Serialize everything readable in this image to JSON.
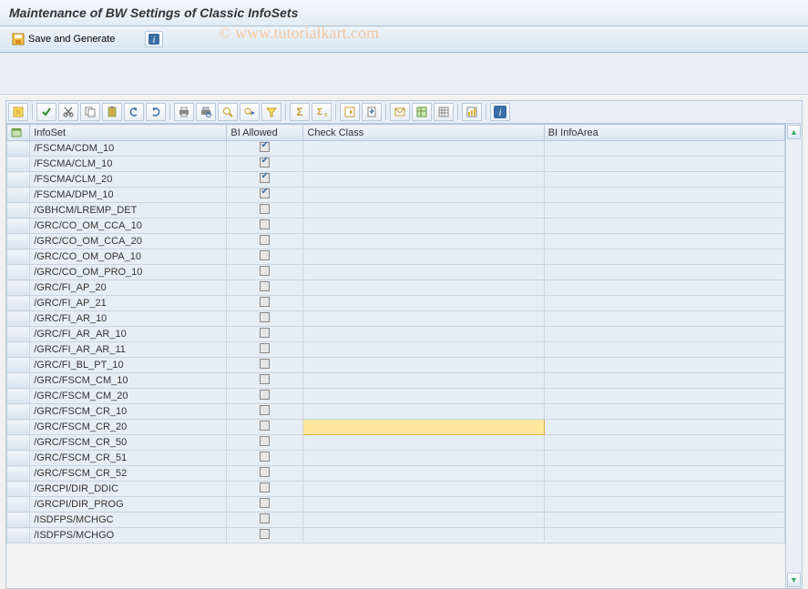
{
  "title": "Maintenance of BW Settings of Classic InfoSets",
  "appbar": {
    "save_label": "Save and Generate"
  },
  "watermark": "© www.tutorialkart.com",
  "columns": {
    "infoset": "InfoSet",
    "bi_allowed": "BI Allowed",
    "check_class": "Check Class",
    "bi_infoarea": "BI InfoArea"
  },
  "rows": [
    {
      "infoset": "/FSCMA/CDM_10",
      "bi": true,
      "cc": "",
      "ia": ""
    },
    {
      "infoset": "/FSCMA/CLM_10",
      "bi": true,
      "cc": "",
      "ia": ""
    },
    {
      "infoset": "/FSCMA/CLM_20",
      "bi": true,
      "cc": "",
      "ia": ""
    },
    {
      "infoset": "/FSCMA/DPM_10",
      "bi": true,
      "cc": "",
      "ia": ""
    },
    {
      "infoset": "/GBHCM/LREMP_DET",
      "bi": false,
      "cc": "",
      "ia": ""
    },
    {
      "infoset": "/GRC/CO_OM_CCA_10",
      "bi": false,
      "cc": "",
      "ia": ""
    },
    {
      "infoset": "/GRC/CO_OM_CCA_20",
      "bi": false,
      "cc": "",
      "ia": ""
    },
    {
      "infoset": "/GRC/CO_OM_OPA_10",
      "bi": false,
      "cc": "",
      "ia": ""
    },
    {
      "infoset": "/GRC/CO_OM_PRO_10",
      "bi": false,
      "cc": "",
      "ia": ""
    },
    {
      "infoset": "/GRC/FI_AP_20",
      "bi": false,
      "cc": "",
      "ia": ""
    },
    {
      "infoset": "/GRC/FI_AP_21",
      "bi": false,
      "cc": "",
      "ia": ""
    },
    {
      "infoset": "/GRC/FI_AR_10",
      "bi": false,
      "cc": "",
      "ia": ""
    },
    {
      "infoset": "/GRC/FI_AR_AR_10",
      "bi": false,
      "cc": "",
      "ia": ""
    },
    {
      "infoset": "/GRC/FI_AR_AR_11",
      "bi": false,
      "cc": "",
      "ia": ""
    },
    {
      "infoset": "/GRC/FI_BL_PT_10",
      "bi": false,
      "cc": "",
      "ia": ""
    },
    {
      "infoset": "/GRC/FSCM_CM_10",
      "bi": false,
      "cc": "",
      "ia": ""
    },
    {
      "infoset": "/GRC/FSCM_CM_20",
      "bi": false,
      "cc": "",
      "ia": ""
    },
    {
      "infoset": "/GRC/FSCM_CR_10",
      "bi": false,
      "cc": "",
      "ia": ""
    },
    {
      "infoset": "/GRC/FSCM_CR_20",
      "bi": false,
      "cc": "",
      "ia": "",
      "editing": true
    },
    {
      "infoset": "/GRC/FSCM_CR_50",
      "bi": false,
      "cc": "",
      "ia": ""
    },
    {
      "infoset": "/GRC/FSCM_CR_51",
      "bi": false,
      "cc": "",
      "ia": ""
    },
    {
      "infoset": "/GRC/FSCM_CR_52",
      "bi": false,
      "cc": "",
      "ia": ""
    },
    {
      "infoset": "/GRCPI/DIR_DDIC",
      "bi": false,
      "cc": "",
      "ia": ""
    },
    {
      "infoset": "/GRCPI/DIR_PROG",
      "bi": false,
      "cc": "",
      "ia": ""
    },
    {
      "infoset": "/ISDFPS/MCHGC",
      "bi": false,
      "cc": "",
      "ia": ""
    },
    {
      "infoset": "/ISDFPS/MCHGO",
      "bi": false,
      "cc": "",
      "ia": ""
    }
  ],
  "toolbar_icons": [
    "details",
    "sep",
    "check",
    "cut",
    "copy",
    "paste",
    "undo",
    "redo",
    "sep",
    "print",
    "print-preview",
    "find",
    "find-next",
    "filter",
    "sep",
    "sum",
    "subtotal",
    "sep",
    "export",
    "local-file",
    "sep",
    "mail",
    "layout",
    "grid-settings",
    "sep",
    "graphic",
    "sep",
    "info"
  ]
}
